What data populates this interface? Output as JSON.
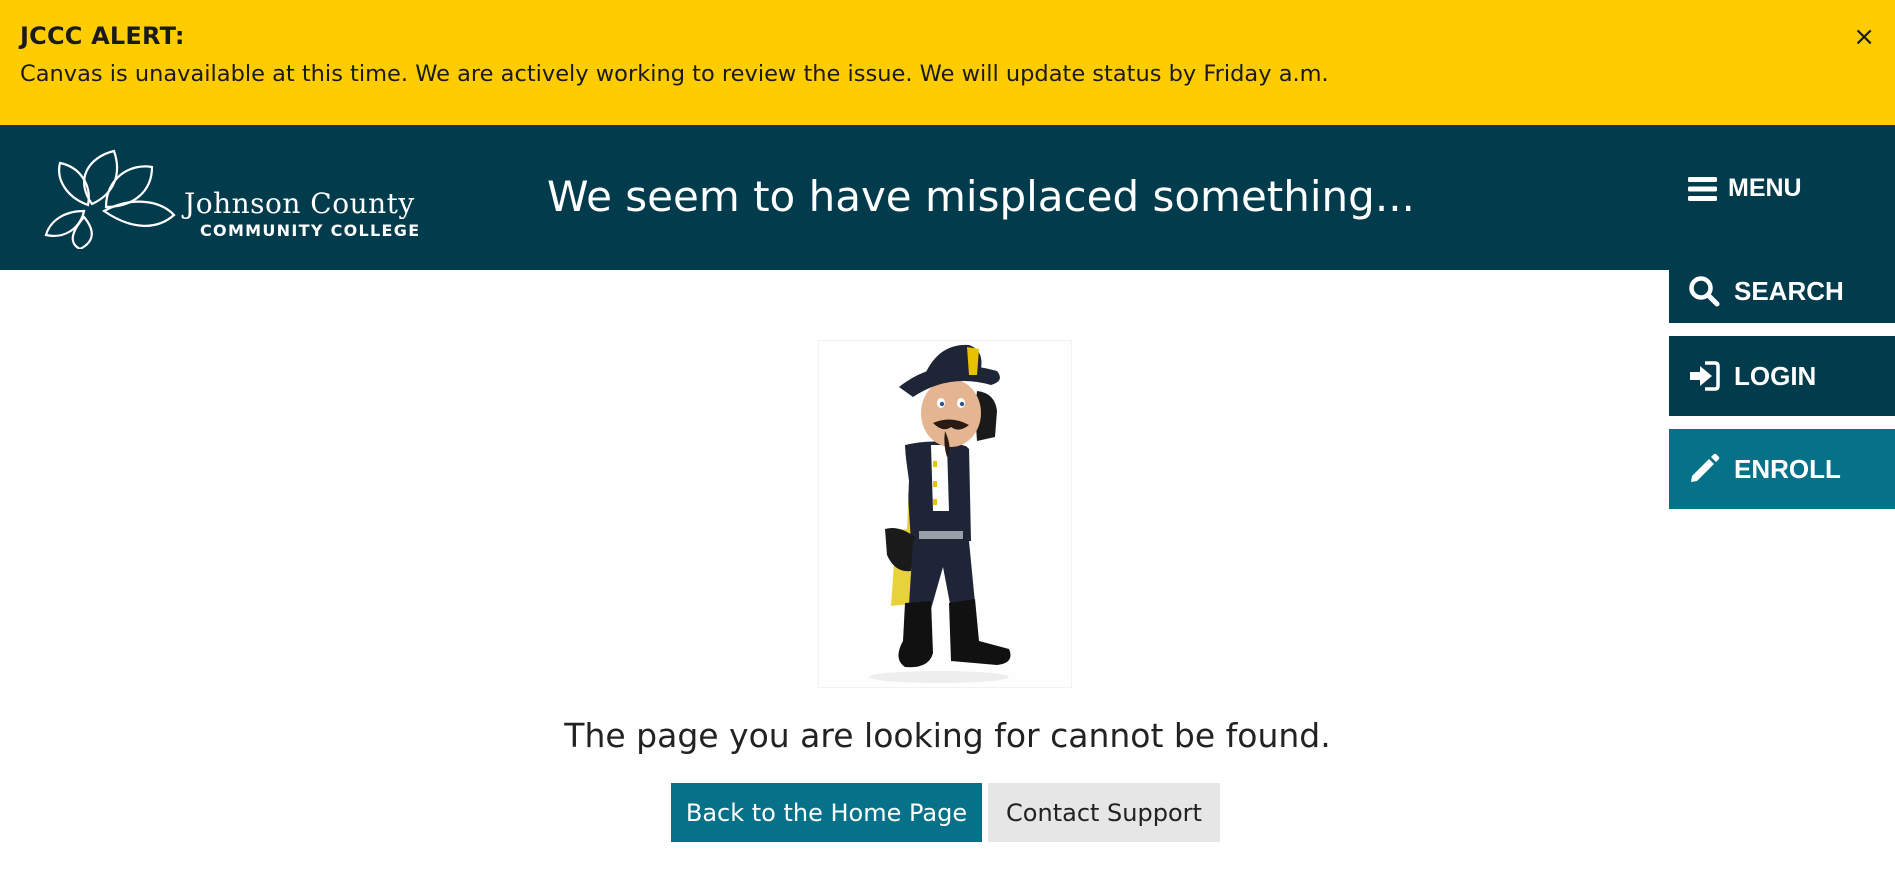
{
  "alert": {
    "title": "JCCC ALERT:",
    "message": "Canvas is unavailable at this time. We are actively working to review the issue. We will update status by Friday a.m.",
    "close_icon": "×",
    "background": "#ffcc00"
  },
  "header": {
    "logo_name": "Johnson County",
    "logo_sub": "COMMUNITY COLLEGE",
    "title": "We seem to have misplaced something...",
    "background": "#023b4c"
  },
  "nav": {
    "menu_label": "MENU",
    "menu_icon": "hamburger-icon",
    "search_label": "SEARCH",
    "search_icon": "search-icon",
    "login_label": "LOGIN",
    "login_icon": "sign-in-icon",
    "enroll_label": "ENROLL",
    "enroll_icon": "pencil-icon",
    "enroll_color": "#05728a"
  },
  "main": {
    "image_subject": "mascot-cavalier",
    "message": "The page you are looking for cannot be found.",
    "home_button": "Back to the Home Page",
    "support_button": "Contact Support"
  }
}
